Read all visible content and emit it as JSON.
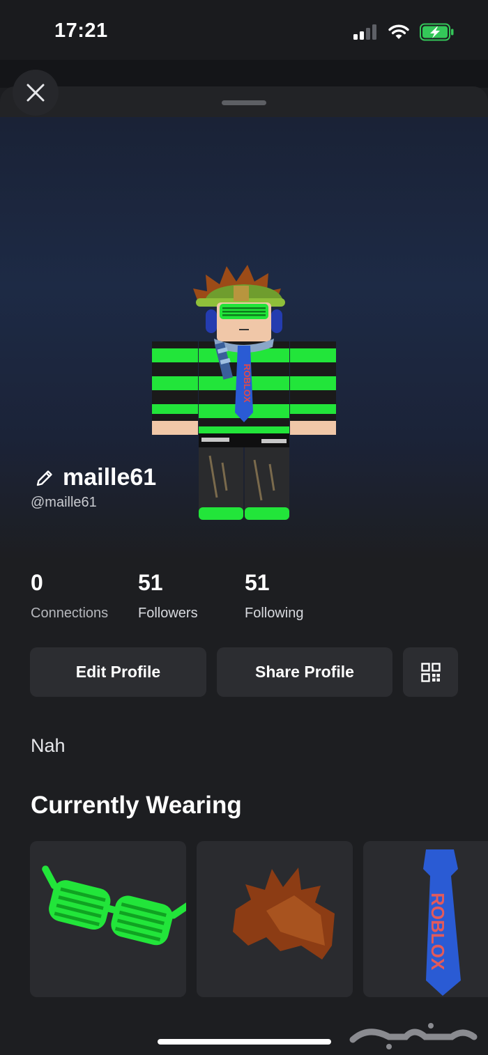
{
  "status_bar": {
    "time": "17:21"
  },
  "profile": {
    "display_name": "maille61",
    "username": "@maille61",
    "bio": "Nah"
  },
  "stats": [
    {
      "value": "0",
      "label": "Connections"
    },
    {
      "value": "51",
      "label": "Followers"
    },
    {
      "value": "51",
      "label": "Following"
    }
  ],
  "actions": {
    "edit_profile": "Edit Profile",
    "share_profile": "Share Profile"
  },
  "wearing": {
    "title": "Currently Wearing",
    "items": [
      "green-shutter-shades",
      "brown-spiky-hair",
      "blue-roblox-tie"
    ]
  },
  "icons": [
    "close-icon",
    "pencil-icon",
    "qr-code-icon",
    "signal-icon",
    "wifi-icon",
    "battery-charging-icon"
  ],
  "colors": {
    "background": "#1d1e21",
    "button": "#2c2d31",
    "accent_green": "#22e53a",
    "battery": "#34c759"
  }
}
